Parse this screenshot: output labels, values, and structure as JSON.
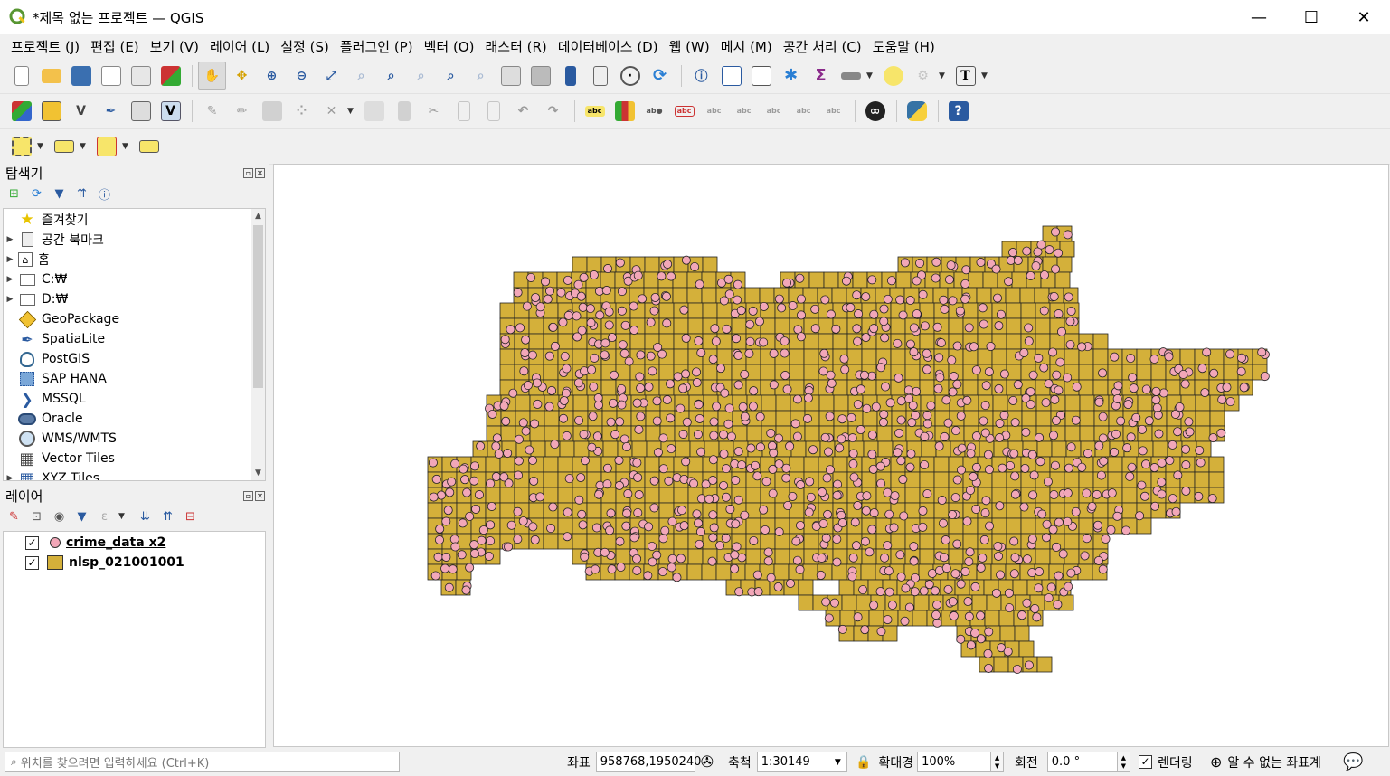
{
  "window": {
    "title": "*제목 없는 프로젝트 — QGIS",
    "minimize": "—",
    "maximize": "☐",
    "close": "✕"
  },
  "menu": [
    "프로젝트 (J)",
    "편집 (E)",
    "보기 (V)",
    "레이어 (L)",
    "설정 (S)",
    "플러그인 (P)",
    "벡터 (O)",
    "래스터 (R)",
    "데이터베이스 (D)",
    "웹 (W)",
    "메시 (M)",
    "공간 처리 (C)",
    "도움말 (H)"
  ],
  "browser": {
    "title": "탐색기",
    "items": [
      {
        "label": "즐겨찾기",
        "icon": "star-icon",
        "arrow": ""
      },
      {
        "label": "공간 북마크",
        "icon": "bookmark-icon",
        "arrow": "▶"
      },
      {
        "label": "홈",
        "icon": "home-icon",
        "arrow": "▶"
      },
      {
        "label": "C:₩",
        "icon": "folder-icon",
        "arrow": "▶"
      },
      {
        "label": "D:₩",
        "icon": "folder-icon",
        "arrow": "▶"
      },
      {
        "label": "GeoPackage",
        "icon": "geopackage-icon",
        "arrow": ""
      },
      {
        "label": "SpatiaLite",
        "icon": "spatialite-icon",
        "arrow": ""
      },
      {
        "label": "PostGIS",
        "icon": "postgis-icon",
        "arrow": ""
      },
      {
        "label": "SAP HANA",
        "icon": "sap-hana-icon",
        "arrow": ""
      },
      {
        "label": "MSSQL",
        "icon": "mssql-icon",
        "arrow": ""
      },
      {
        "label": "Oracle",
        "icon": "oracle-icon",
        "arrow": ""
      },
      {
        "label": "WMS/WMTS",
        "icon": "globe-icon",
        "arrow": ""
      },
      {
        "label": "Vector Tiles",
        "icon": "grid-icon",
        "arrow": ""
      },
      {
        "label": "XYZ Tiles",
        "icon": "grid-icon",
        "arrow": "▶"
      }
    ]
  },
  "layers": {
    "title": "레이어",
    "items": [
      {
        "name": "crime_data x2",
        "checked": "✓",
        "symbol": "point"
      },
      {
        "name": "nlsp_021001001",
        "checked": "✓",
        "symbol": "polygon"
      }
    ]
  },
  "status": {
    "locator_placeholder": "위치를 찾으려면 입력하세요 (Ctrl+K)",
    "coord_label": "좌표",
    "coord_value": "958768,1950240",
    "scale_label": "축척",
    "scale_value": "1:30149",
    "magnifier_label": "확대경",
    "magnifier_value": "100%",
    "rotation_label": "회전",
    "rotation_value": "0.0 °",
    "render_label": "렌더링",
    "render_checked": "✓",
    "crs_label": "알 수 없는 좌표계"
  },
  "colors": {
    "polygon_fill": "#d4b03a",
    "point_fill": "#f2a7b8",
    "outline": "#222222"
  }
}
